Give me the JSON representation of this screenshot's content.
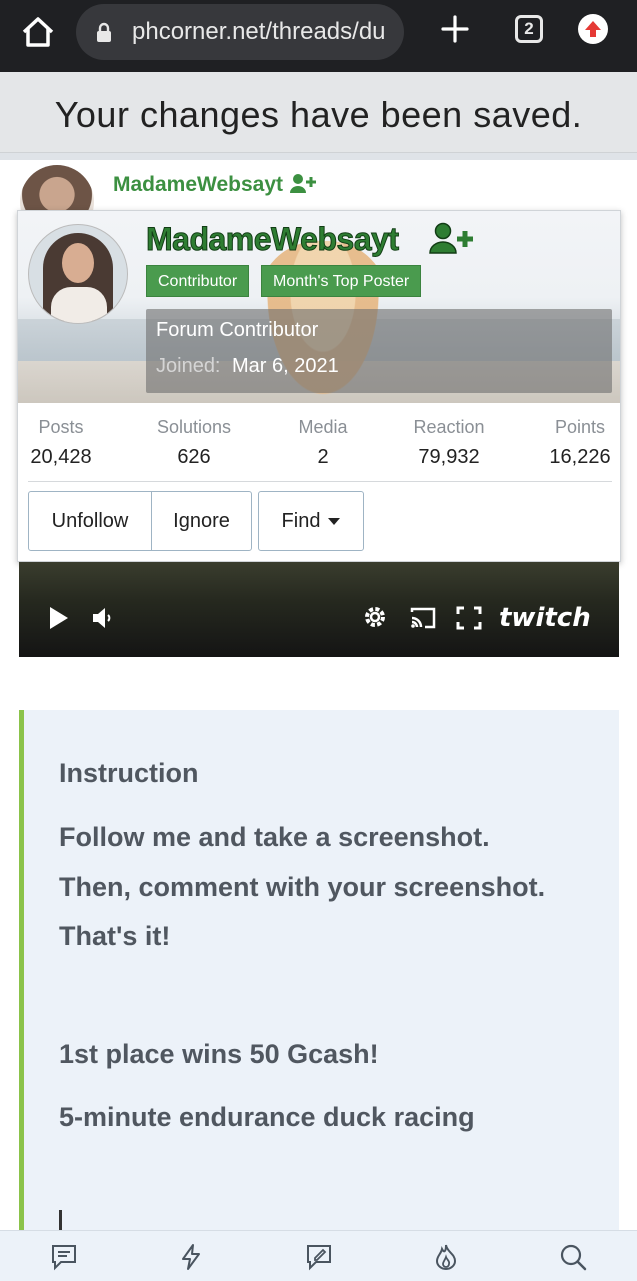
{
  "browser": {
    "url": "phcorner.net/threads/du",
    "tab_count": "2",
    "icons": [
      "home-icon",
      "lock-icon",
      "new-tab-icon",
      "tabs-icon",
      "update-icon"
    ]
  },
  "toast": {
    "message": "Your changes have been saved."
  },
  "author": {
    "name": "MadameWebsayt"
  },
  "member_card": {
    "name": "MadameWebsayt",
    "badges": [
      "Contributor",
      "Month's Top Poster"
    ],
    "title": "Forum Contributor",
    "joined_label": "Joined:",
    "joined_value": "Mar 6, 2021",
    "stats": [
      {
        "label": "Posts",
        "value": "20,428"
      },
      {
        "label": "Solutions",
        "value": "626"
      },
      {
        "label": "Media",
        "value": "2"
      },
      {
        "label": "Reaction",
        "value": "79,932"
      },
      {
        "label": "Points",
        "value": "16,226"
      }
    ],
    "buttons": {
      "unfollow": "Unfollow",
      "ignore": "Ignore",
      "find": "Find"
    },
    "name_color": "#2e7d32",
    "badge_color": "#4a9b4e"
  },
  "video": {
    "brand": "twitch"
  },
  "quote": {
    "lines": [
      "Instruction",
      "Follow me and take a screenshot.",
      "Then, comment with your screenshot.",
      "That's it!",
      "1st place wins 50 Gcash!",
      "5-minute endurance duck racing"
    ],
    "accent_color": "#8bc34a"
  },
  "bottom_nav": {
    "icons": [
      "chat-icon",
      "lightning-icon",
      "edit-icon",
      "fire-icon",
      "search-icon"
    ]
  }
}
